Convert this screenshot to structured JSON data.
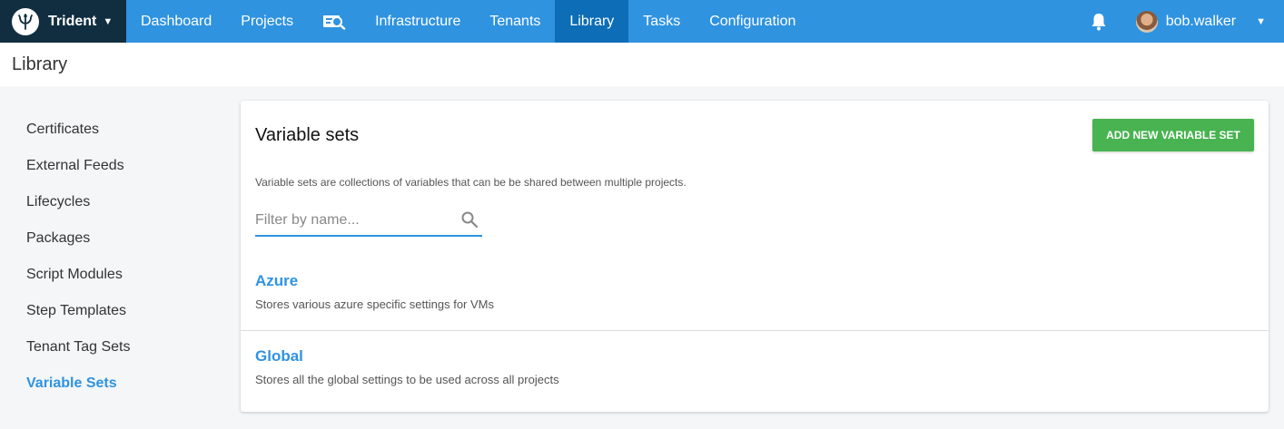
{
  "nav": {
    "space": "Trident",
    "items": [
      {
        "label": "Dashboard"
      },
      {
        "label": "Projects"
      },
      {
        "label": "Infrastructure"
      },
      {
        "label": "Tenants"
      },
      {
        "label": "Library"
      },
      {
        "label": "Tasks"
      },
      {
        "label": "Configuration"
      }
    ],
    "user": "bob.walker"
  },
  "page": {
    "title": "Library"
  },
  "sidebar": {
    "items": [
      {
        "label": "Certificates"
      },
      {
        "label": "External Feeds"
      },
      {
        "label": "Lifecycles"
      },
      {
        "label": "Packages"
      },
      {
        "label": "Script Modules"
      },
      {
        "label": "Step Templates"
      },
      {
        "label": "Tenant Tag Sets"
      },
      {
        "label": "Variable Sets"
      }
    ],
    "active": "Variable Sets"
  },
  "main": {
    "title": "Variable sets",
    "add_button": "ADD NEW VARIABLE SET",
    "description": "Variable sets are collections of variables that can be be shared between multiple projects.",
    "filter_placeholder": "Filter by name...",
    "variable_sets": [
      {
        "name": "Azure",
        "description": "Stores various azure specific settings for VMs"
      },
      {
        "name": "Global",
        "description": "Stores all the global settings to be used across all projects"
      }
    ]
  },
  "colors": {
    "nav_blue": "#2f93e0",
    "active_nav": "#0d6db6",
    "space_dark": "#102e40",
    "add_green": "#48b350",
    "link_blue": "#2f93e0"
  }
}
